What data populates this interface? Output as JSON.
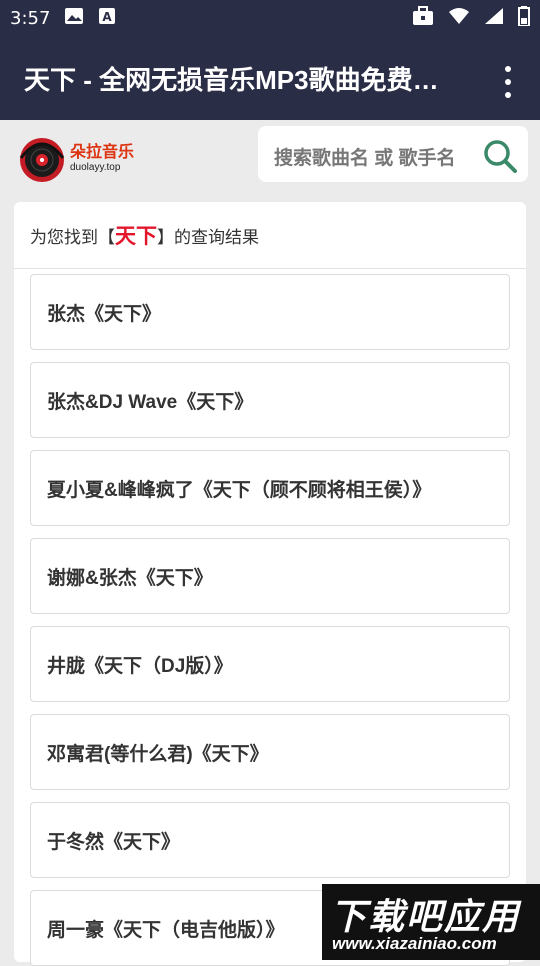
{
  "status_bar": {
    "time": "3:57",
    "left_icons": [
      "image-icon",
      "a-icon"
    ],
    "right_icons": [
      "briefcase-icon",
      "wifi-icon",
      "signal-icon",
      "battery-icon"
    ]
  },
  "app_bar": {
    "title": "天下 - 全网无损音乐MP3歌曲免费…",
    "menu_icon": "more-vert-icon"
  },
  "logo": {
    "title": "朵拉音乐",
    "domain": "duolayy.top"
  },
  "search": {
    "placeholder": "搜索歌曲名 或 歌手名",
    "icon": "search-icon"
  },
  "results": {
    "prefix": "为您找到【",
    "query": "天下",
    "suffix": "】的查询结果",
    "items": [
      "张杰《天下》",
      "张杰&DJ Wave《天下》",
      "夏小夏&峰峰疯了《天下（顾不顾将相王侯）》",
      "谢娜&张杰《天下》",
      "井胧《天下（DJ版）》",
      "邓寓君(等什么君)《天下》",
      "于冬然《天下》",
      "周一豪《天下（电吉他版）》"
    ]
  },
  "watermark": {
    "text": "下载吧应用",
    "url": "www.xiazainiao.com"
  },
  "colors": {
    "app_bar": "#2a2d46",
    "accent_red": "#e4162c",
    "search_icon": "#3a8a6a"
  }
}
